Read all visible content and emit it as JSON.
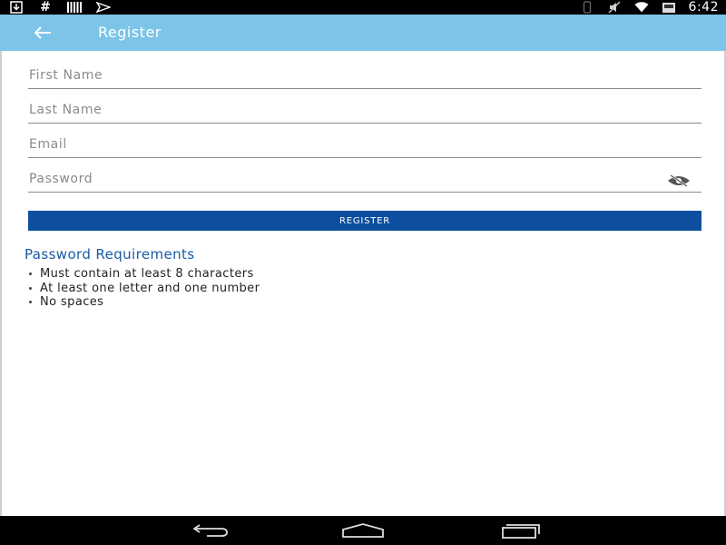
{
  "statusbar": {
    "left_icons": [
      "download-icon",
      "hash-icon",
      "barcode-icon",
      "send-icon"
    ],
    "right_icons": [
      "vibrate-icon",
      "mute-icon",
      "wifi-icon",
      "battery-icon"
    ],
    "hash_glyph": "#",
    "time": "6:42"
  },
  "appbar": {
    "title": "Register",
    "back_icon": "arrow-back-icon",
    "color": "#7cc4e8"
  },
  "form": {
    "first_name": {
      "placeholder": "First Name",
      "value": ""
    },
    "last_name": {
      "placeholder": "Last Name",
      "value": ""
    },
    "email": {
      "placeholder": "Email",
      "value": ""
    },
    "password": {
      "placeholder": "Password",
      "value": "",
      "toggle_icon": "eye-off-icon"
    },
    "register_label": "REGISTER",
    "button_color": "#0d4f9e"
  },
  "requirements": {
    "title": "Password Requirements",
    "items": [
      "Must contain at least 8 characters",
      "At least one letter and one number",
      "No spaces"
    ]
  },
  "navbar": {
    "icons": [
      "nav-back-icon",
      "nav-home-icon",
      "nav-recents-icon"
    ]
  }
}
